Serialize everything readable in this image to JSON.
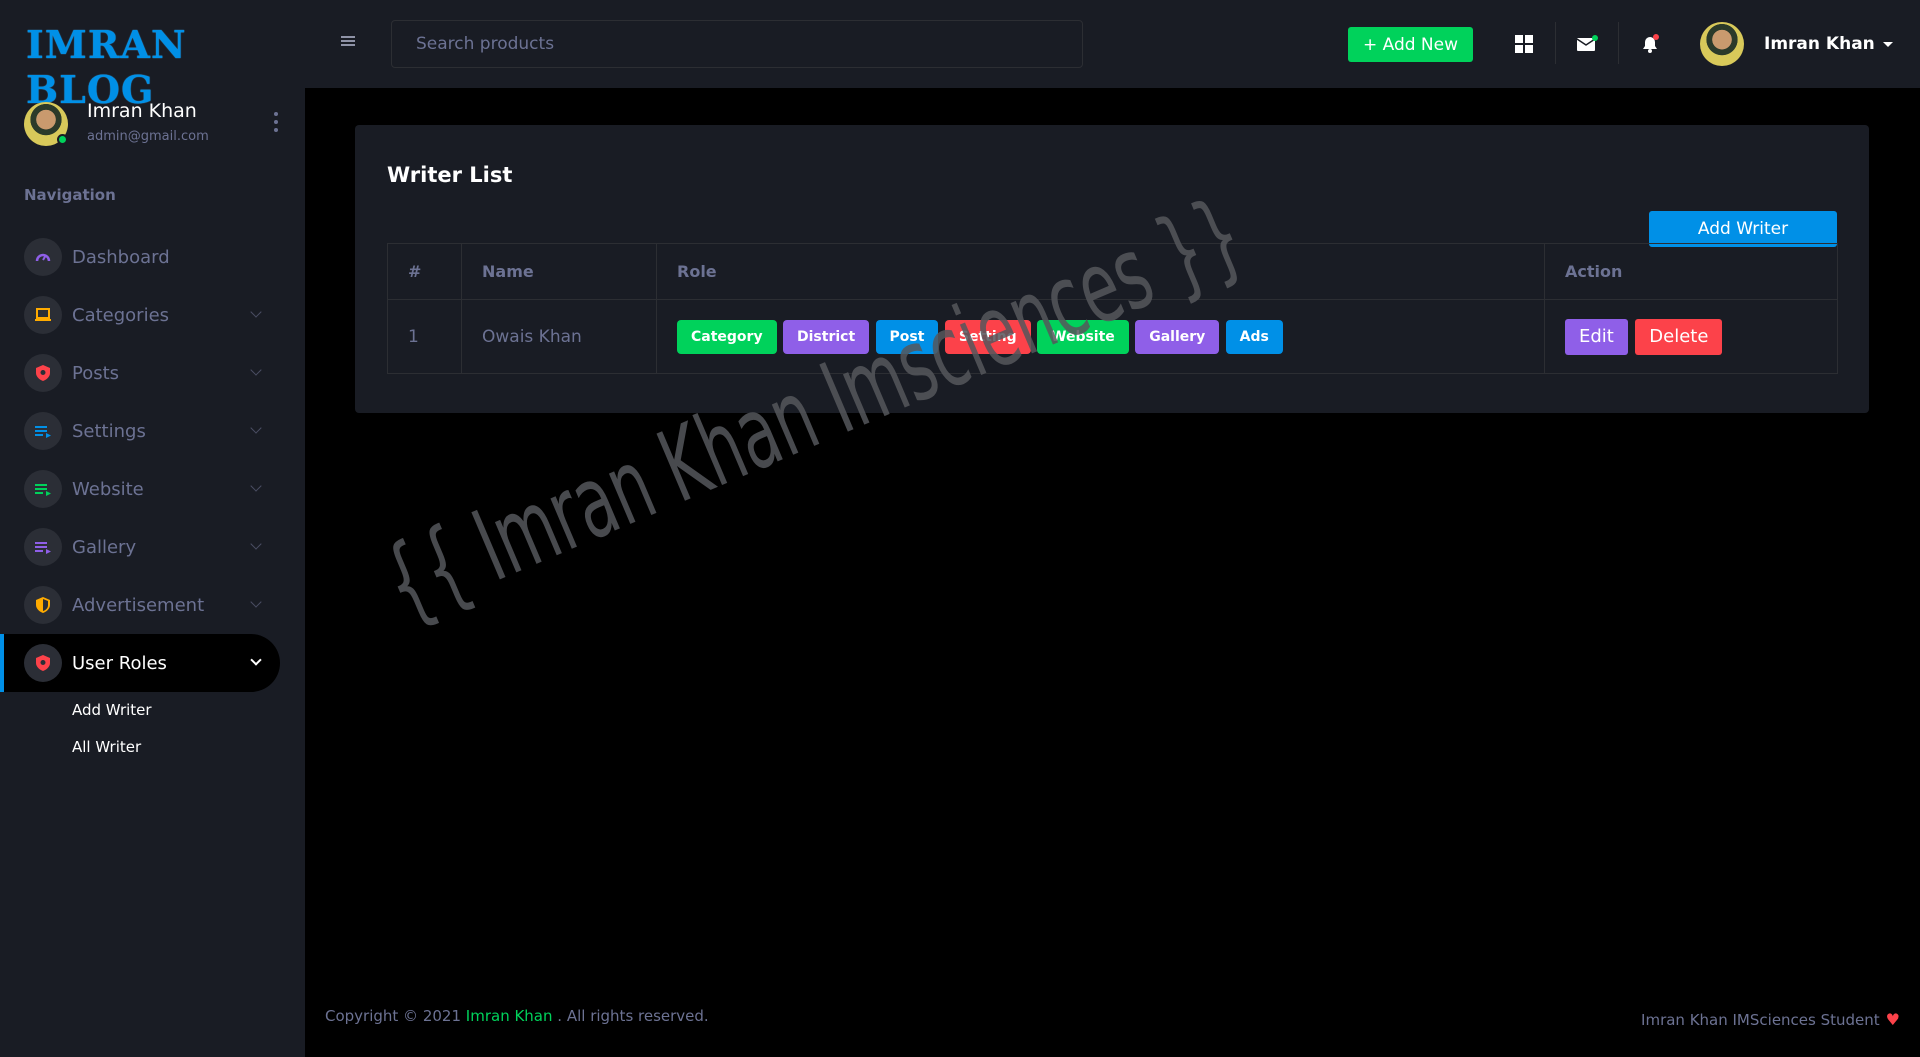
{
  "brand": {
    "logo_text": "IMRAN BLOG"
  },
  "sidebar": {
    "profile": {
      "name": "Imran Khan",
      "email": "admin@gmail.com"
    },
    "nav_heading": "Navigation",
    "items": [
      {
        "label": "Dashboard",
        "icon": "speedometer-icon",
        "icon_color": "#8f5fe8"
      },
      {
        "label": "Categories",
        "icon": "laptop-icon",
        "icon_color": "#ffab00"
      },
      {
        "label": "Posts",
        "icon": "shield-icon",
        "icon_color": "#fc424a"
      },
      {
        "label": "Settings",
        "icon": "list-icon",
        "icon_color": "#0090e7"
      },
      {
        "label": "Website",
        "icon": "list-icon",
        "icon_color": "#00d25b"
      },
      {
        "label": "Gallery",
        "icon": "list-icon",
        "icon_color": "#8f5fe8"
      },
      {
        "label": "Advertisement",
        "icon": "shield-icon",
        "icon_color": "#ffab00"
      },
      {
        "label": "User Roles",
        "icon": "shield-icon",
        "icon_color": "#fc424a"
      }
    ],
    "submenu": [
      {
        "label": "Add Writer"
      },
      {
        "label": "All Writer"
      }
    ]
  },
  "header": {
    "search_placeholder": "Search products",
    "add_new_label": "+ Add New",
    "user_name": "Imran Khan"
  },
  "card": {
    "title": "Writer List",
    "add_writer_label": "Add Writer",
    "columns": [
      "#",
      "Name",
      "Role",
      "Action"
    ],
    "rows": [
      {
        "index": "1",
        "name": "Owais Khan",
        "roles": [
          {
            "label": "Category",
            "color": "#00d25b"
          },
          {
            "label": "District",
            "color": "#8f5fe8"
          },
          {
            "label": "Post",
            "color": "#0090e7"
          },
          {
            "label": "Setting",
            "color": "#fc424a"
          },
          {
            "label": "Website",
            "color": "#00d25b"
          },
          {
            "label": "Gallery",
            "color": "#8f5fe8"
          },
          {
            "label": "Ads",
            "color": "#0090e7"
          }
        ],
        "edit_label": "Edit",
        "delete_label": "Delete"
      }
    ]
  },
  "watermark": "{{ Imran Khan Imsciences }}",
  "footer": {
    "left_prefix": "Copyright © 2021",
    "left_link": "Imran Khan",
    "left_suffix": ". All rights reserved.",
    "right_text": "Imran Khan IMSciences Student"
  },
  "colors": {
    "accent_blue": "#0090e7",
    "success_green": "#00d25b",
    "purple": "#8f5fe8",
    "danger_red": "#fc424a",
    "warning_yellow": "#ffab00"
  }
}
